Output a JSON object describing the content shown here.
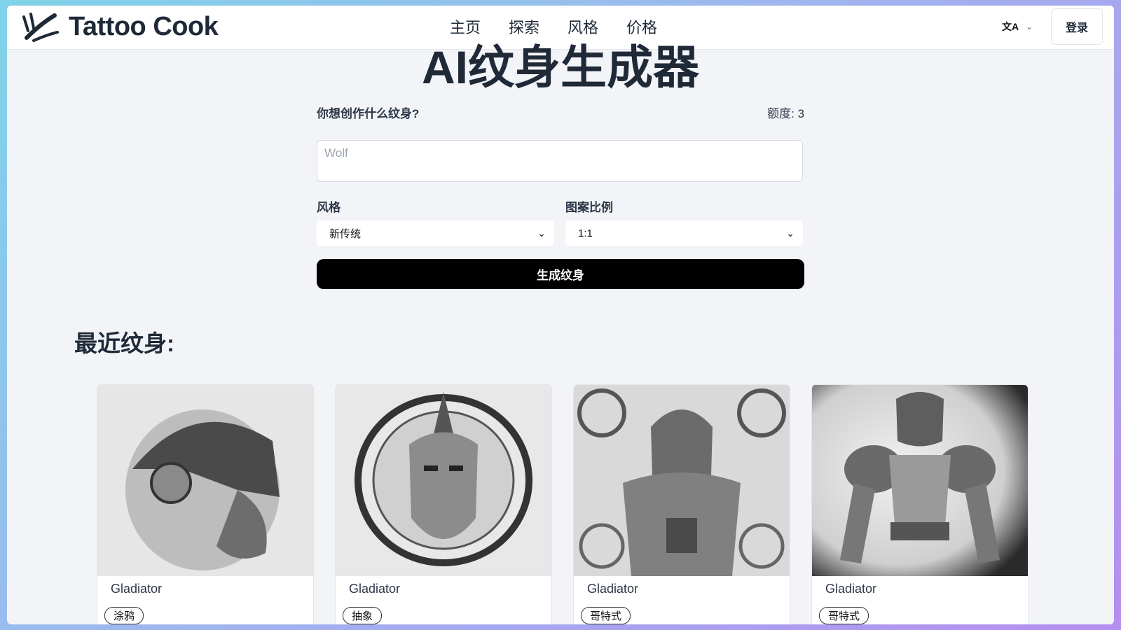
{
  "header": {
    "brand": "Tattoo Cook",
    "nav": [
      "主页",
      "探索",
      "风格",
      "价格"
    ],
    "lang_icon": "translate-icon",
    "login_label": "登录"
  },
  "main": {
    "title": "AI纹身生成器",
    "prompt_label": "你想创作什么纹身?",
    "credits": "额度: 3",
    "prompt_placeholder": "Wolf",
    "style_label": "风格",
    "style_value": "新传统",
    "ratio_label": "图案比例",
    "ratio_value": "1:1",
    "generate_label": "生成纹身"
  },
  "recent": {
    "title": "最近纹身:",
    "cards": [
      {
        "title": "Gladiator",
        "tag": "涂鸦",
        "image": "gladiator-helmet-profile-sketch"
      },
      {
        "title": "Gladiator",
        "tag": "抽象",
        "image": "gladiator-face-circular-emblem"
      },
      {
        "title": "Gladiator",
        "tag": "哥特式",
        "image": "gladiator-ornate-gothic-warrior"
      },
      {
        "title": "Gladiator",
        "tag": "哥特式",
        "image": "gladiator-armored-muscular-warrior"
      }
    ]
  }
}
